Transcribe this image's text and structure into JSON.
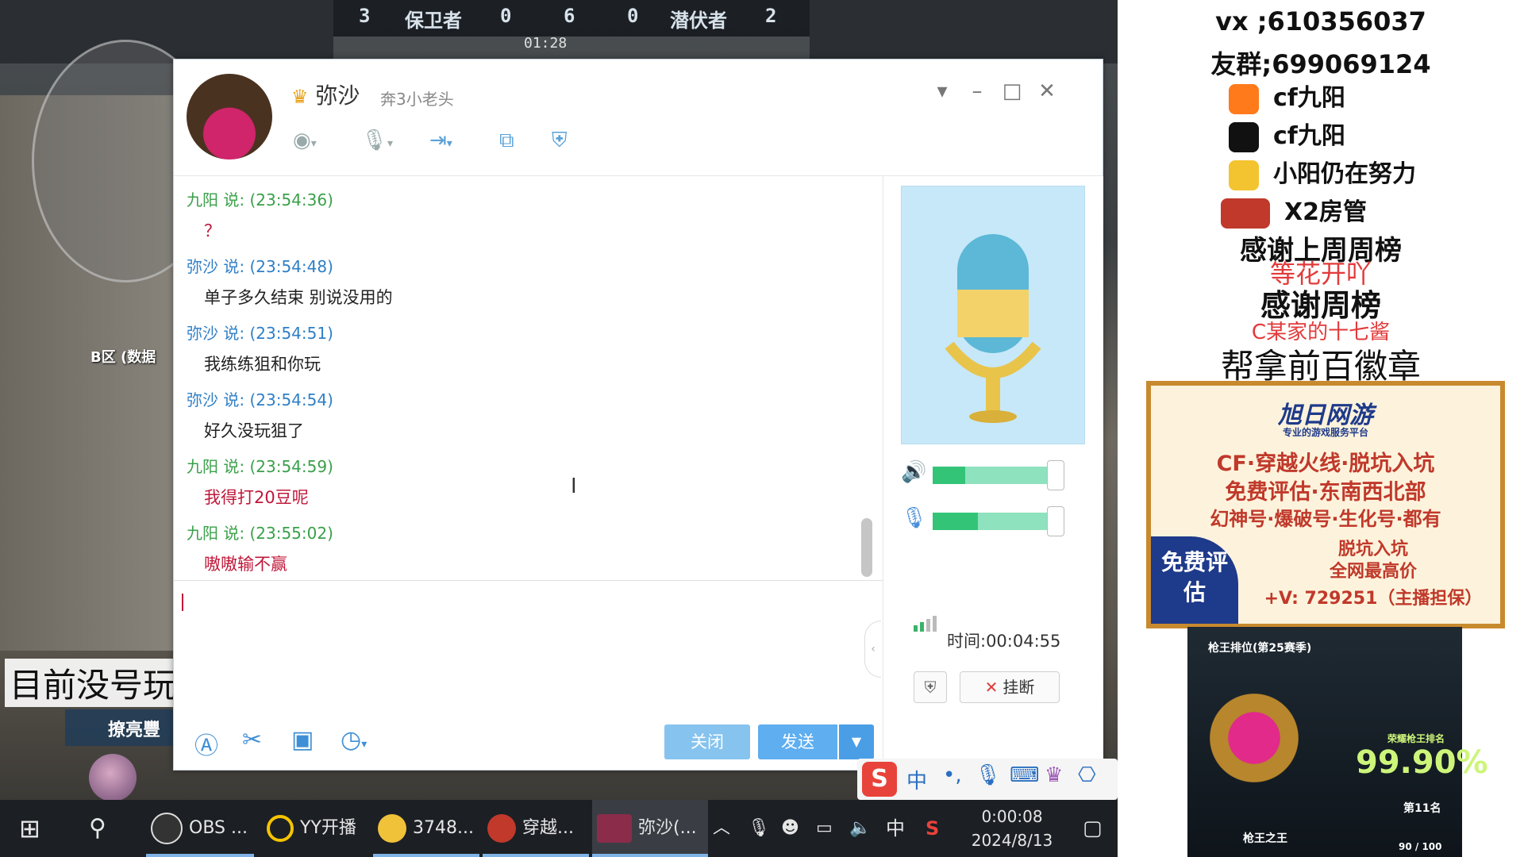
{
  "hud": {
    "score_left": "3",
    "team_left": "保卫者",
    "kills_left": "0",
    "round": "6",
    "kills_right": "0",
    "team_right": "潜伏者",
    "score_right": "2",
    "timer": "01:28"
  },
  "game": {
    "map_label": "B区 (数据",
    "overlay_text": "目前没号玩儿",
    "player_name": "撩亮豐"
  },
  "chat_window": {
    "contact_name": "弥沙",
    "signature": "奔3小老头",
    "messages": [
      {
        "sender": "九阳",
        "meta": "九阳 说: (23:54:36)",
        "text": "？",
        "style": "red"
      },
      {
        "sender": "弥沙",
        "meta": "弥沙 说: (23:54:48)",
        "text": "单子多久结束 别说没用的",
        "style": "black"
      },
      {
        "sender": "弥沙",
        "meta": "弥沙 说: (23:54:51)",
        "text": "我练练狙和你玩",
        "style": "black"
      },
      {
        "sender": "弥沙",
        "meta": "弥沙 说: (23:54:54)",
        "text": "好久没玩狙了",
        "style": "black"
      },
      {
        "sender": "九阳",
        "meta": "九阳 说: (23:54:59)",
        "text": "我得打20豆呢",
        "style": "red"
      },
      {
        "sender": "九阳",
        "meta": "九阳 说: (23:55:02)",
        "text": "嗷嗷输不赢",
        "style": "red"
      }
    ],
    "close_label": "关闭",
    "send_label": "发送",
    "call_time": "时间:00:04:55",
    "hangup_label": "挂断",
    "speaker_level": 0.25,
    "mic_level": 0.35
  },
  "right_panel": {
    "vx": "vx ;610356037",
    "fan_group": "友群;699069124",
    "social": [
      {
        "icon": "kuaishou-icon",
        "label": "cf九阳",
        "color": "#ff7a1a"
      },
      {
        "icon": "douyin-icon",
        "label": "cf九阳",
        "color": "#111111"
      },
      {
        "icon": "weibo-icon",
        "label": "小阳仍在努力",
        "color": "#f4c430"
      },
      {
        "icon": "plane-icon",
        "label": "X2房管",
        "color": "#c0392b"
      }
    ],
    "thanks_last_week": "感谢上周周榜",
    "thanks_last_week_name": "等花开吖",
    "thanks_week": "感谢周榜",
    "thanks_week_name": "C某家的十七酱",
    "badge_text": "帮拿前百徽章",
    "ad": {
      "brand": "旭日网游",
      "brand_sub": "专业的游戏服务平台",
      "line1": "CF·穿越火线·脱坑入坑",
      "line2": "免费评估·东南西北部",
      "line3": "幻神号·爆破号·生化号·都有",
      "line4": "脱坑入坑",
      "line5": "全网最高价",
      "free_label": "免费评估",
      "contact": "+V: 729251（主播担保）"
    },
    "rank": {
      "title": "枪王排位(第25赛季)",
      "subtitle": "荣耀枪王排名",
      "percent": "99.90%",
      "place": "第11名",
      "tier": "枪王之王",
      "progress": "90 / 100"
    }
  },
  "taskbar": {
    "apps": [
      {
        "icon": "obs-icon",
        "label": "OBS ..."
      },
      {
        "icon": "yy-icon",
        "label": "YY开播"
      },
      {
        "icon": "panda-icon",
        "label": "3748..."
      },
      {
        "icon": "cf-icon",
        "label": "穿越..."
      },
      {
        "icon": "chat-app-icon",
        "label": "弥沙(..."
      }
    ],
    "ime_label": "中",
    "time": "0:00:08",
    "date": "2024/8/13"
  }
}
